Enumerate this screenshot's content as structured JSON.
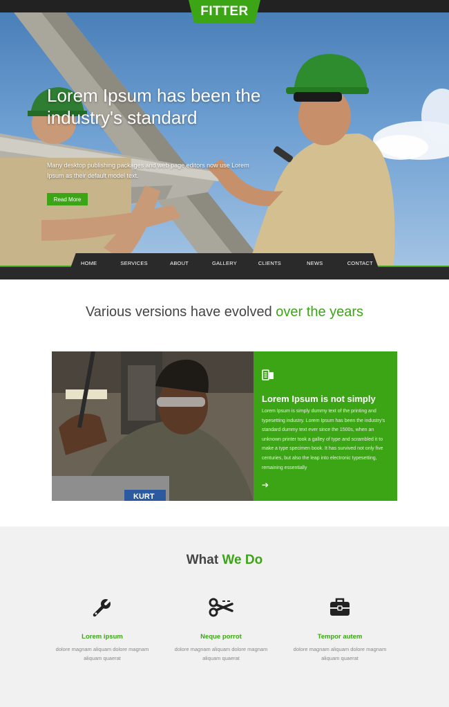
{
  "brand": {
    "logo": "FITTER",
    "accent": "#3ba515",
    "dark": "#222222"
  },
  "hero": {
    "title": "Lorem Ipsum has been the industry's standard",
    "text": "Many desktop publishing packages and web page editors now use Lorem Ipsum as their default model text.",
    "button": "Read More"
  },
  "nav": {
    "items": [
      "HOME",
      "SERVICES",
      "ABOUT",
      "GALLERY",
      "CLIENTS",
      "NEWS",
      "CONTACT"
    ]
  },
  "section1": {
    "title_plain": "Various versions have evolved",
    "title_accent": "over the years",
    "feature": {
      "icon": "document-icon",
      "title": "Lorem Ipsum is not simply",
      "text": "Lorem Ipsum is simply dummy text of the printing and typesetting industry. Lorem Ipsum has been the industry's standard dummy text ever since the 1500s, when an unknown printer took a galley of type and scrambled it to make a type specimen book. It has survived not only five centuries, but also the leap into electronic typesetting, remaining essentially",
      "arrow_icon": "arrow-right-icon"
    }
  },
  "section2": {
    "title_plain": "What",
    "title_accent": "We Do",
    "services": [
      {
        "icon": "wrench-icon",
        "title": "Lorem ipsum",
        "text": "dolore magnam aliquam dolore magnam aliquam quaerat"
      },
      {
        "icon": "scissors-icon",
        "title": "Neque porrot",
        "text": "dolore magnam aliquam dolore magnam aliquam quaerat"
      },
      {
        "icon": "briefcase-icon",
        "title": "Tempor autem",
        "text": "dolore magnam aliquam dolore magnam aliquam quaerat"
      }
    ]
  }
}
